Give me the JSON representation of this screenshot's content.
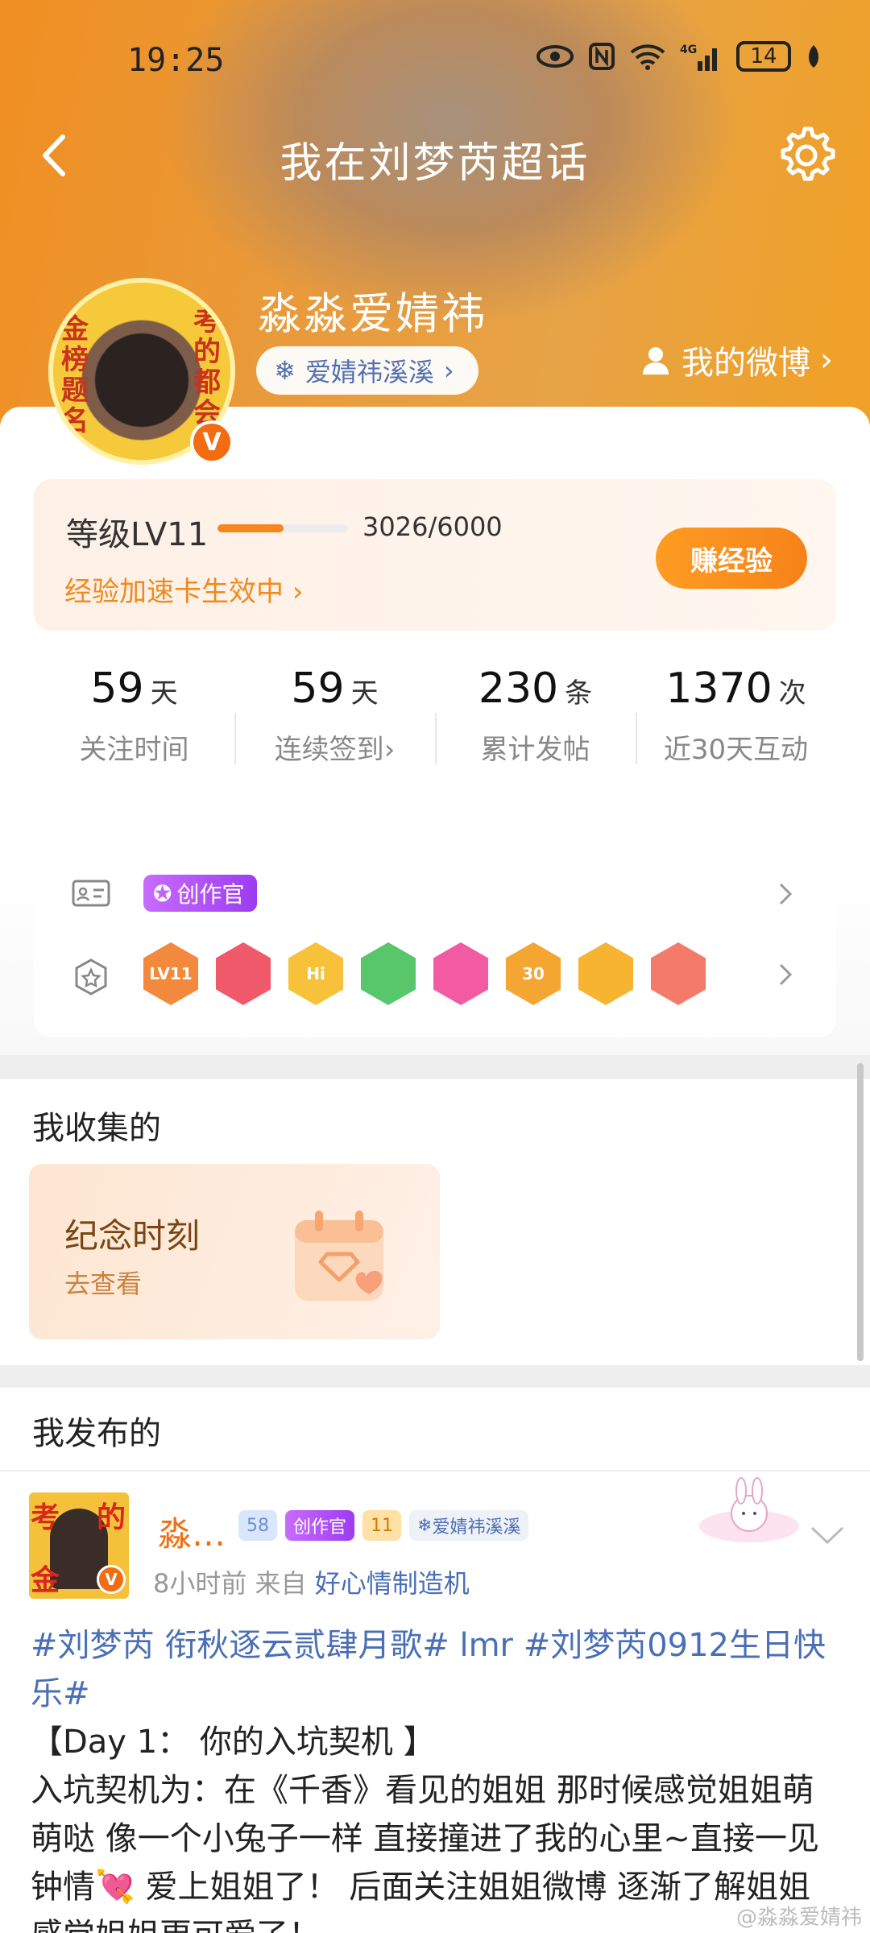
{
  "status_bar": {
    "time": "19:25",
    "battery": "14",
    "network": "4G"
  },
  "header": {
    "title": "我在刘梦芮超话"
  },
  "profile": {
    "username": "淼淼爱婧祎",
    "fan_badge": "爱婧祎溪溪",
    "my_weibo": "我的微博",
    "avatar_text": [
      "金",
      "榜",
      "题",
      "名",
      "考",
      "的",
      "都",
      "会"
    ]
  },
  "level": {
    "label": "等级LV11",
    "progress_text": "3026/6000",
    "progress_fraction": 0.504,
    "boost_text": "经验加速卡生效中",
    "earn_button": "赚经验"
  },
  "stats": [
    {
      "num": "59",
      "unit": "天",
      "label": "关注时间"
    },
    {
      "num": "59",
      "unit": "天",
      "label": "连续签到"
    },
    {
      "num": "230",
      "unit": "条",
      "label": "累计发帖"
    },
    {
      "num": "1370",
      "unit": "次",
      "label": "近30天互动"
    }
  ],
  "honors": {
    "creator_tag": "创作官",
    "medals": [
      {
        "text": "LV11",
        "color": "#f2893c"
      },
      {
        "text": "",
        "color": "#f0596a"
      },
      {
        "text": "Hi",
        "color": "#f7c13a"
      },
      {
        "text": "",
        "color": "#58c66a"
      },
      {
        "text": "",
        "color": "#f25aa2"
      },
      {
        "text": "30",
        "color": "#f5a532"
      },
      {
        "text": "",
        "color": "#f7b431"
      },
      {
        "text": "",
        "color": "#f47a6a"
      }
    ]
  },
  "collect": {
    "title": "我收集的",
    "card_title": "纪念时刻",
    "card_sub": "去查看"
  },
  "published": {
    "title": "我发布的",
    "post": {
      "name": "淼…",
      "badges": [
        "58",
        "创作官",
        "11",
        "爱婧祎溪溪"
      ],
      "time": "8小时前",
      "from_label": "来自",
      "source": "好心情制造机",
      "tags_line": "#刘梦芮 衔秋逐云贰肆月歌# lmr #刘梦芮0912生日快乐#",
      "line2": "【Day 1： 你的入坑契机 】",
      "line3": "入坑契机为：在《千香》看见的姐姐 那时候感觉姐姐萌萌哒 像一个小兔子一样 直接撞进了我的心里~直接一见钟情💘 爱上姐姐了！ 后面关注姐姐微博 逐渐了解姐姐 感觉姐姐更可爱了！"
    }
  },
  "watermark": "@淼淼爱婧祎"
}
